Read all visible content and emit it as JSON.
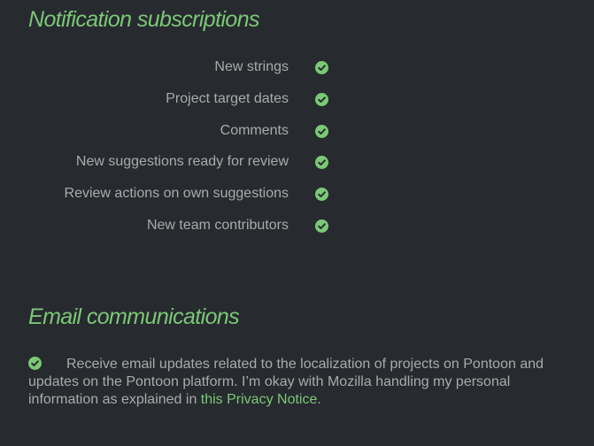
{
  "notifications": {
    "title": "Notification subscriptions",
    "items": [
      {
        "label": "New strings",
        "checked": true
      },
      {
        "label": "Project target dates",
        "checked": true
      },
      {
        "label": "Comments",
        "checked": true
      },
      {
        "label": "New suggestions ready for review",
        "checked": true
      },
      {
        "label": "Review actions on own suggestions",
        "checked": true
      },
      {
        "label": "New team contributors",
        "checked": true
      }
    ]
  },
  "email": {
    "title": "Email communications",
    "checked": true,
    "text_before": "Receive email updates related to the localization of projects on Pontoon and updates on the Pontoon platform. I’m okay with Mozilla handling my personal information as explained in ",
    "link_text": "this Privacy Notice",
    "text_after": "."
  },
  "colors": {
    "background": "#272a2f",
    "accent": "#7bc876",
    "text": "#aaaaaa"
  },
  "icons": {
    "check": "check-circle-icon"
  }
}
